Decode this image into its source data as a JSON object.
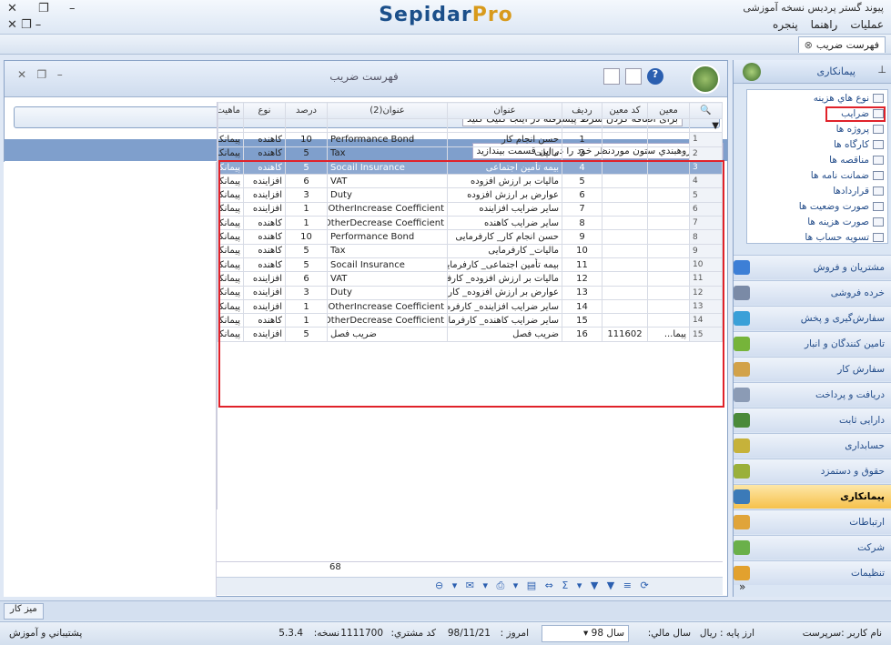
{
  "window": {
    "app_title": "SepidarPro",
    "org_title": "پیوند گستر پردیس نسخه آموزشی"
  },
  "menu": [
    "عملیات",
    "راهنما",
    "پنجره"
  ],
  "doc_tab": "فهرست ضریب",
  "main_title": "فهرست ضریب",
  "filter_hint": "برای اضافه کردن شرط پیشرفته در اینجا کلیک کنید",
  "group_hint": "جهت گروهبندي ستون موردنظر خود را در این قسمت بیندازید",
  "columns": [
    "معین",
    "کد معین",
    "ردیف",
    "عنوان",
    "عنوان(2)",
    "درصد",
    "نوع",
    "ماهیت"
  ],
  "rows": [
    {
      "n": "1",
      "no": "1",
      "title": "حسن انجام کار",
      "title2": "Performance Bond",
      "pct": "10",
      "type": "کاهنده",
      "nature": "پیمانکاری"
    },
    {
      "n": "2",
      "no": "2",
      "title": "مالیات",
      "title2": "Tax",
      "pct": "5",
      "type": "کاهنده",
      "nature": "پیمانکاری"
    },
    {
      "n": "3",
      "no": "4",
      "title": "بیمه تأمین اجتماعی",
      "title2": "Socail Insurance",
      "pct": "5",
      "type": "کاهنده",
      "nature": "پیمانکاری",
      "sel": true
    },
    {
      "n": "4",
      "no": "5",
      "title": "مالیات بر ارزش افزوده",
      "title2": "VAT",
      "pct": "6",
      "type": "افزاینده",
      "nature": "پیمانکاری"
    },
    {
      "n": "5",
      "no": "6",
      "title": "عوارض بر ارزش افزوده",
      "title2": "Duty",
      "pct": "3",
      "type": "افزاینده",
      "nature": "پیمانکاری"
    },
    {
      "n": "6",
      "no": "7",
      "title": "سایر ضرایب افزاینده",
      "title2": "OtherIncrease Coefficient",
      "pct": "1",
      "type": "افزاینده",
      "nature": "پیمانکاری"
    },
    {
      "n": "7",
      "no": "8",
      "title": "سایر ضرایب کاهنده",
      "title2": "OtherDecrease Coefficient",
      "pct": "1",
      "type": "کاهنده",
      "nature": "پیمانکاری"
    },
    {
      "n": "8",
      "no": "9",
      "title": "حسن انجام کار_ کارفرمایی",
      "title2": "Performance Bond",
      "pct": "10",
      "type": "کاهنده",
      "nature": "پیمانکارجزء"
    },
    {
      "n": "9",
      "no": "10",
      "title": "مالیات_ کارفرمایی",
      "title2": "Tax",
      "pct": "5",
      "type": "کاهنده",
      "nature": "پیمانکارجزء"
    },
    {
      "n": "10",
      "no": "11",
      "title": "بیمه تأمین اجتماعی_ کارفرمایی",
      "title2": "Socail Insurance",
      "pct": "5",
      "type": "کاهنده",
      "nature": "پیمانکارجزء"
    },
    {
      "n": "11",
      "no": "12",
      "title": "مالیات بر ارزش افزوده_ کارفرمایی",
      "title2": "VAT",
      "pct": "6",
      "type": "افزاینده",
      "nature": "پیمانکارجزء"
    },
    {
      "n": "12",
      "no": "13",
      "title": "عوارض بر ارزش افزوده_ کارفرمایی",
      "title2": "Duty",
      "pct": "3",
      "type": "افزاینده",
      "nature": "پیمانکارجزء"
    },
    {
      "n": "13",
      "no": "14",
      "title": "سایر ضرایب افزاینده_ کارفرمایی",
      "title2": "OtherIncrease Coefficient",
      "pct": "1",
      "type": "افزاینده",
      "nature": "پیمانکارجزء"
    },
    {
      "n": "14",
      "no": "15",
      "title": "سایر ضرایب کاهنده_ کارفرمایی",
      "title2": "OtherDecrease Coefficient",
      "pct": "1",
      "type": "کاهنده",
      "nature": "پیمانکارجزء"
    },
    {
      "n": "15",
      "no": "16",
      "code": "111602",
      "moin": "پیما...",
      "title": "ضریب فصل",
      "title2": "ضریب فصل",
      "pct": "5",
      "type": "افزاینده",
      "nature": "پیمانکاری"
    }
  ],
  "total_pct": "68",
  "sidebar": {
    "header": "پیمانکاری",
    "tree": [
      "نوع هاي هزينه",
      "ضرايب",
      "پروژه ها",
      "کارگاه ها",
      "مناقصه ها",
      "ضمانت نامه ها",
      "قراردادها",
      "صورت وضعيت ها",
      "صورت هزينه ها",
      "تسويه حساب ها"
    ],
    "modules": [
      {
        "label": "مشتریان و فروش",
        "color": "#3d7fd6"
      },
      {
        "label": "خرده فروشی",
        "color": "#7a8aa6"
      },
      {
        "label": "سفارش‌گیری و پخش",
        "color": "#3aa0d8"
      },
      {
        "label": "تامین کنندگان و انبار",
        "color": "#76b43a"
      },
      {
        "label": "سفارش کار",
        "color": "#d2a24a"
      },
      {
        "label": "دریافت و پرداخت",
        "color": "#8b9bb5"
      },
      {
        "label": "دارایی ثابت",
        "color": "#4a8a3a"
      },
      {
        "label": "حسابداری",
        "color": "#c6b23a"
      },
      {
        "label": "حقوق و دستمزد",
        "color": "#9ab03a"
      },
      {
        "label": "پیمانکاری",
        "color": "#3b7ab8",
        "active": true
      },
      {
        "label": "ارتباطات",
        "color": "#e0a43a"
      },
      {
        "label": "شرکت",
        "color": "#6ab04a"
      },
      {
        "label": "تنظیمات",
        "color": "#e2a12e"
      }
    ]
  },
  "taskbar_btn": "میز کار",
  "status": {
    "user": "نام کاربر :سرپرست",
    "base_currency": "ارز پایه : ریال",
    "fiscal_year_label": "سال مالي:",
    "fiscal_year": "سال 98",
    "today_label": "امروز :",
    "today": "98/11/21",
    "customer_label": "کد مشتري:",
    "customer": "1111700",
    "version_label": "نسخه:",
    "version": "5.3.4",
    "support": "پشتيباني و آموزش"
  }
}
